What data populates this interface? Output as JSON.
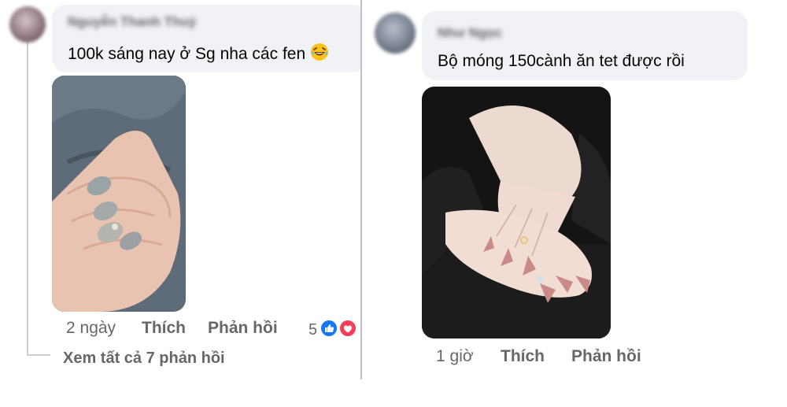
{
  "left_comment": {
    "author": "Nguyễn Thanh Thuý",
    "text": "100k sáng nay ở Sg nha các fen",
    "emoji": "laughing-tears-emoji",
    "time": "2 ngày",
    "like_label": "Thích",
    "reply_label": "Phản hồi",
    "reaction_count": "5",
    "reactions": [
      "like-reaction-icon",
      "love-reaction-icon"
    ],
    "view_replies": "Xem tất cả 7 phản hồi"
  },
  "right_comment": {
    "author": "Như Ngọc",
    "text": "Bộ móng 150cành ăn tet được rồi",
    "time": "1 giờ",
    "like_label": "Thích",
    "reply_label": "Phản hồi"
  },
  "colors": {
    "bubble": "#f0f2f5",
    "meta_text": "#65676b",
    "like_blue": "#1877f2",
    "love_red": "#f33e58"
  }
}
